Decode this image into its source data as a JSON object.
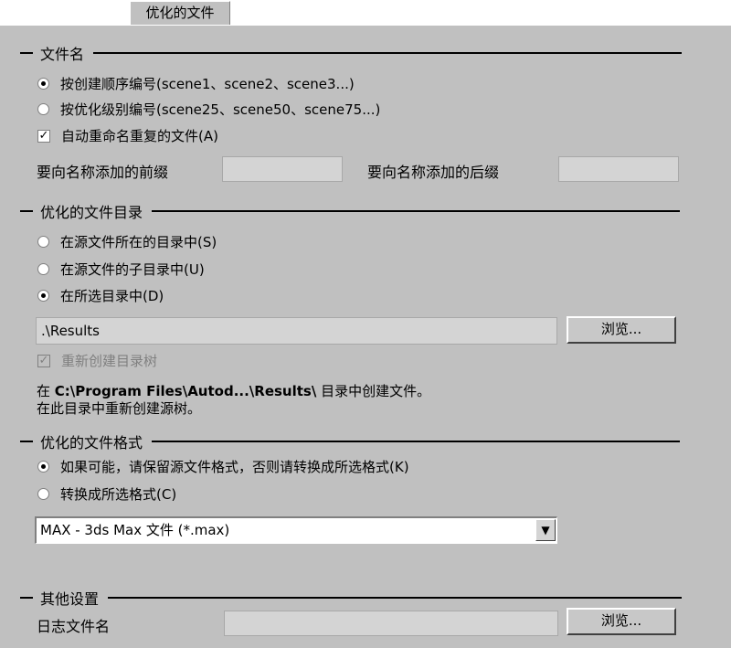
{
  "tab": {
    "label": "优化的文件"
  },
  "file_name_group": {
    "title": "文件名",
    "radio_creation_order": {
      "label": "按创建顺序编号(scene1、scene2、scene3...)",
      "checked": true
    },
    "radio_optimize_level": {
      "label": "按优化级别编号(scene25、scene50、scene75...)",
      "checked": false
    },
    "auto_rename": {
      "label": "自动重命名重复的文件(A)",
      "checked": true
    },
    "prefix_label": "要向名称添加的前缀",
    "prefix_value": "",
    "suffix_label": "要向名称添加的后缀",
    "suffix_value": ""
  },
  "directory_group": {
    "title": "优化的文件目录",
    "radio_source_dir": {
      "label": "在源文件所在的目录中(S)",
      "checked": false
    },
    "radio_source_subdir": {
      "label": "在源文件的子目录中(U)",
      "checked": false
    },
    "radio_selected_dir": {
      "label": "在所选目录中(D)",
      "checked": true
    },
    "path_value": ".\\Results",
    "browse_label": "浏览...",
    "recreate_tree": {
      "label": "重新创建目录树",
      "checked": true,
      "disabled": true
    },
    "info_line1_prefix": "在",
    "info_line1_path": "C:\\Program Files\\Autod...\\Results\\",
    "info_line1_suffix": "目录中创建文件。",
    "info_line2": "在此目录中重新创建源树。"
  },
  "format_group": {
    "title": "优化的文件格式",
    "radio_keep_format": {
      "label": "如果可能，请保留源文件格式，否则请转换成所选格式(K)",
      "checked": true
    },
    "radio_convert": {
      "label": "转换成所选格式(C)",
      "checked": false
    },
    "format_selected": "MAX - 3ds Max 文件 (*.max)"
  },
  "other_group": {
    "title": "其他设置",
    "log_label": "日志文件名",
    "log_value": "",
    "browse_label": "浏览..."
  }
}
